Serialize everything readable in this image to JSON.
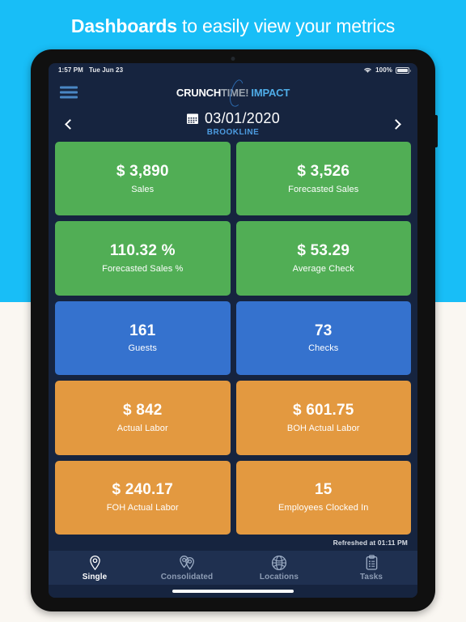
{
  "headline": {
    "bold": "Dashboards",
    "rest": " to easily view your metrics"
  },
  "colors": {
    "page_top": "#18BEF7",
    "page_bottom": "#FAF7F2",
    "app_background": "#16243F",
    "tabbar": "#1F3050",
    "green": "#51AE55",
    "blue": "#3572CE",
    "orange": "#E39940",
    "accent_blue": "#4C9BE0"
  },
  "status_bar": {
    "time": "1:57 PM",
    "date": "Tue Jun 23",
    "wifi_icon": "wifi-icon",
    "battery_percent": "100%",
    "battery_icon": "battery-full-icon"
  },
  "topbar": {
    "menu_icon": "hamburger-menu-icon",
    "logo": {
      "part1": "CRUNCH",
      "part2": "TIME!",
      "part3": "IMPACT"
    }
  },
  "date_nav": {
    "prev_icon": "chevron-left-icon",
    "next_icon": "chevron-right-icon",
    "calendar_icon": "calendar-icon",
    "date": "03/01/2020",
    "location": "BROOKLINE"
  },
  "cards": [
    {
      "value": "$ 3,890",
      "label": "Sales",
      "color": "green"
    },
    {
      "value": "$ 3,526",
      "label": "Forecasted Sales",
      "color": "green"
    },
    {
      "value": "110.32 %",
      "label": "Forecasted Sales %",
      "color": "green"
    },
    {
      "value": "$ 53.29",
      "label": "Average Check",
      "color": "green"
    },
    {
      "value": "161",
      "label": "Guests",
      "color": "blue"
    },
    {
      "value": "73",
      "label": "Checks",
      "color": "blue"
    },
    {
      "value": "$ 842",
      "label": "Actual Labor",
      "color": "orange"
    },
    {
      "value": "$ 601.75",
      "label": "BOH Actual Labor",
      "color": "orange"
    },
    {
      "value": "$ 240.17",
      "label": "FOH Actual Labor",
      "color": "orange"
    },
    {
      "value": "15",
      "label": "Employees Clocked In",
      "color": "orange"
    }
  ],
  "refreshed": "Refreshed at 01:11 PM",
  "tabs": [
    {
      "label": "Single",
      "icon": "map-pin-icon",
      "active": true
    },
    {
      "label": "Consolidated",
      "icon": "map-pins-double-icon",
      "active": false
    },
    {
      "label": "Locations",
      "icon": "globe-icon",
      "active": false
    },
    {
      "label": "Tasks",
      "icon": "clipboard-icon",
      "active": false
    }
  ]
}
